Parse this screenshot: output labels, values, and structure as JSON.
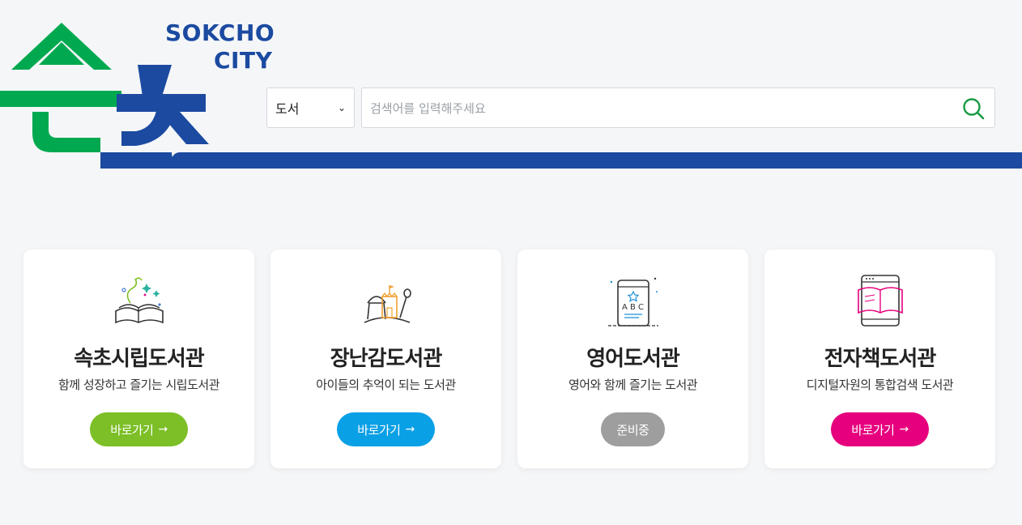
{
  "logo": {
    "line1": "SOKCHO",
    "line2": "CITY",
    "icon": "sokcho-logo-icon",
    "colors": {
      "green": "#00a94f",
      "blue": "#1b4aa0"
    }
  },
  "search": {
    "category": "도서",
    "placeholder": "검색어를 입력해주세요",
    "value": "",
    "button_icon": "search-icon",
    "accent": "#1a9a45"
  },
  "libraries": [
    {
      "title": "속초시립도서관",
      "desc": "함께 성장하고 즐기는 시립도서관",
      "button": "바로가기",
      "arrow": "→",
      "button_color": "#7cbf26",
      "icon": "open-book-icon"
    },
    {
      "title": "장난감도서관",
      "desc": "아이들의 추억이 되는 도서관",
      "button": "바로가기",
      "arrow": "→",
      "button_color": "#0aa0e6",
      "icon": "sandcastle-icon"
    },
    {
      "title": "영어도서관",
      "desc": "영어와 함께 즐기는 도서관",
      "button": "준비중",
      "arrow": "",
      "button_color": "#9e9e9e",
      "icon": "abc-tablet-icon"
    },
    {
      "title": "전자책도서관",
      "desc": "디지털자원의 통합검색 도서관",
      "button": "바로가기",
      "arrow": "→",
      "button_color": "#e6007e",
      "icon": "ebook-tablet-icon"
    }
  ]
}
